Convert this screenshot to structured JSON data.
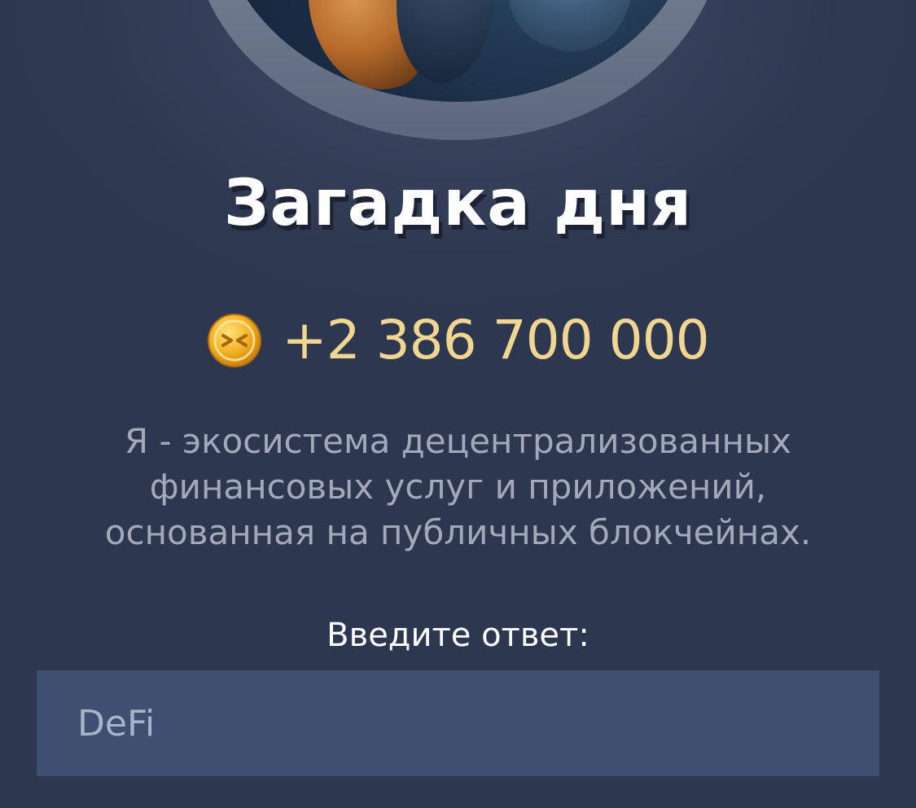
{
  "header": {
    "title": "Загадка дня"
  },
  "reward": {
    "icon": "gold-coin-icon",
    "amount": "+2 386 700 000"
  },
  "riddle": {
    "text": "Я - экосистема децентрализованных финансовых услуг и приложений, основанная на публичных блокчейнах."
  },
  "answer": {
    "label": "Введите ответ:",
    "placeholder": "DeFi",
    "value": ""
  },
  "colors": {
    "background": "#2e3750",
    "title": "#ffffff",
    "reward_amount": "#f1d691",
    "description": "#a3a9b8",
    "input_background": "#3f4f72",
    "coin": "#f0b429"
  }
}
